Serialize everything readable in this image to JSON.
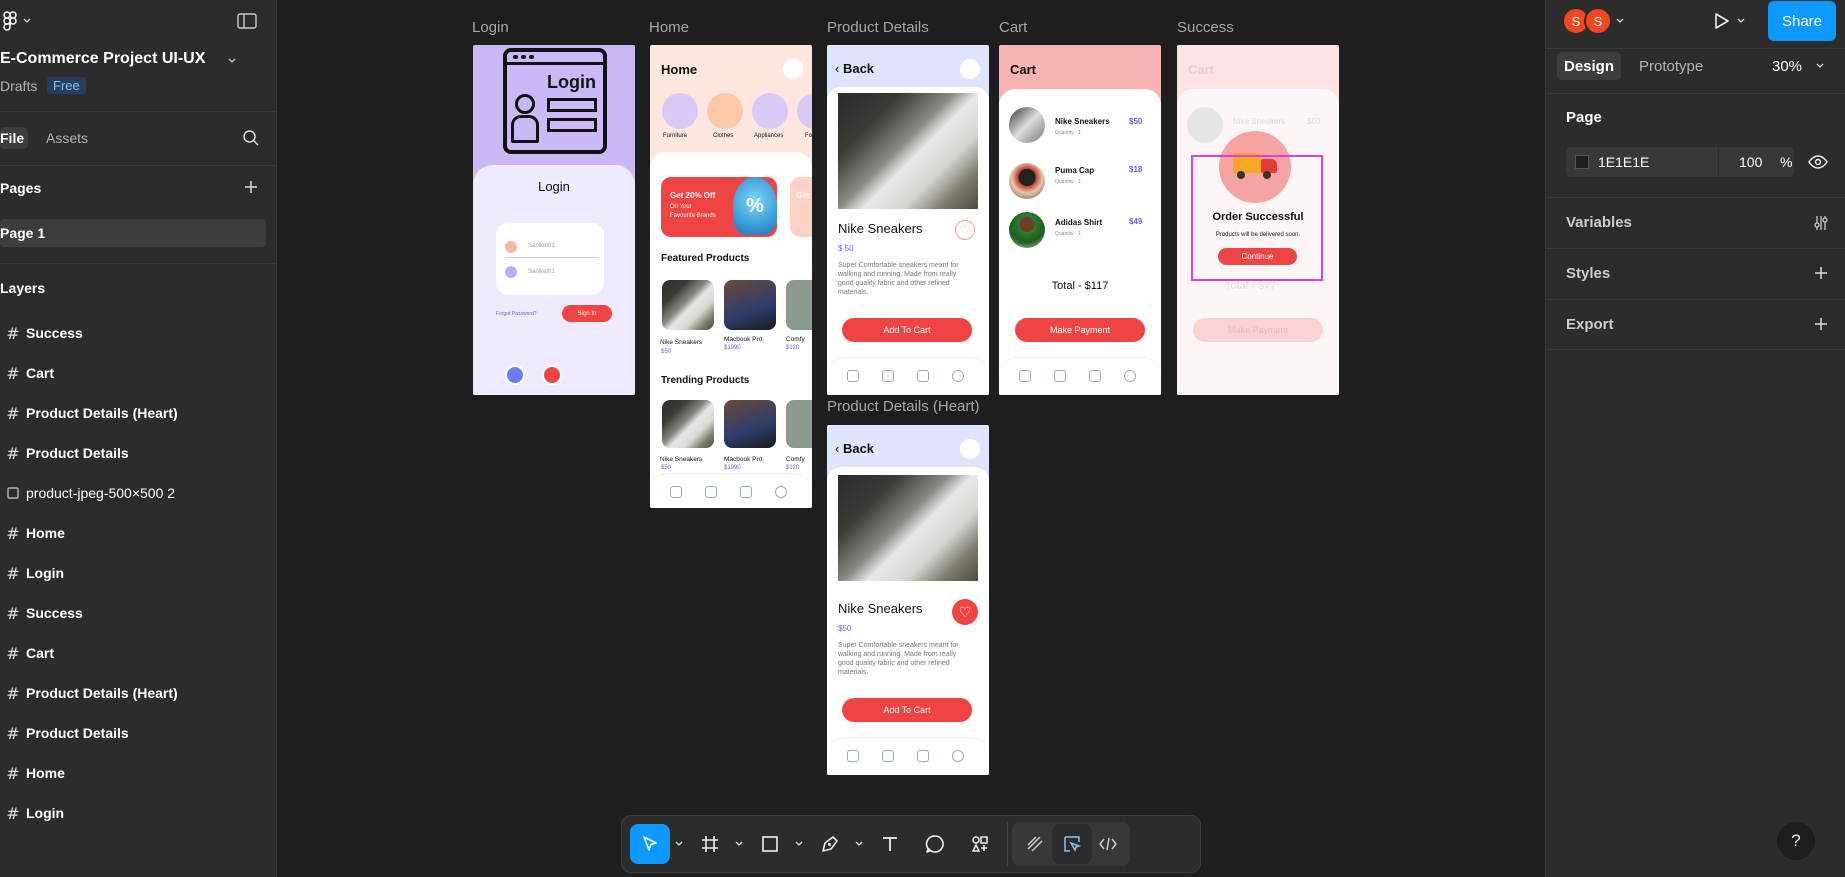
{
  "left": {
    "project_title": "E-Commerce Project UI-UX",
    "drafts": "Drafts",
    "plan_badge": "Free",
    "tabs": [
      "File",
      "Assets"
    ],
    "pages_heading": "Pages",
    "page_item": "Page 1",
    "layers_heading": "Layers",
    "layers": [
      {
        "name": "Success",
        "icon": "frame-icon"
      },
      {
        "name": "Cart",
        "icon": "frame-icon"
      },
      {
        "name": "Product Details (Heart)",
        "icon": "frame-icon"
      },
      {
        "name": "Product Details",
        "icon": "frame-icon"
      },
      {
        "name": "product-jpeg-500×500 2",
        "icon": "image-icon"
      },
      {
        "name": "Home",
        "icon": "frame-icon"
      },
      {
        "name": "Login",
        "icon": "frame-icon"
      },
      {
        "name": "Success",
        "icon": "frame-icon"
      },
      {
        "name": "Cart",
        "icon": "frame-icon"
      },
      {
        "name": "Product Details (Heart)",
        "icon": "frame-icon"
      },
      {
        "name": "Product Details",
        "icon": "frame-icon"
      },
      {
        "name": "Home",
        "icon": "frame-icon"
      },
      {
        "name": "Login",
        "icon": "frame-icon"
      }
    ]
  },
  "canvas": {
    "frame_labels": {
      "login": "Login",
      "home": "Home",
      "product_details": "Product Details",
      "cart": "Cart",
      "success": "Success",
      "product_details_heart": "Product Details (Heart)"
    },
    "login": {
      "illustration_text": "Login",
      "title": "Login",
      "username": "Saniket01",
      "password": "Saniket01",
      "forgot": "Forgot Password?",
      "sign_in": "Sign In"
    },
    "home": {
      "title": "Home",
      "categories": [
        "Furniture",
        "Clothes",
        "Appliances",
        "Fo"
      ],
      "banner_line1": "Get 20% Off",
      "banner_line2": "On Your",
      "banner_line3": "Favourite Brands",
      "banner_badge": "%",
      "banner2_text": "Get",
      "featured_heading": "Featured Products",
      "trending_heading": "Trending Products",
      "products": [
        {
          "name": "Nike Sneakers",
          "price": "$50"
        },
        {
          "name": "Macbook Pro",
          "price": "$1990"
        },
        {
          "name": "Comfy",
          "price": "$120"
        }
      ]
    },
    "product": {
      "back": "Back",
      "name": "Nike Sneakers",
      "price": "$ 50",
      "price_heart": "$50",
      "description": "Super Comfortable sneakers meant for walking and running. Made from really good quality fabric and other refined materials.",
      "add_to_cart": "Add To Cart"
    },
    "cart": {
      "title": "Cart",
      "quantity_label": "Quantity - 1",
      "items": [
        {
          "name": "Nike Sneakers",
          "price": "$50"
        },
        {
          "name": "Puma Cap",
          "price": "$18"
        },
        {
          "name": "Adidas Shirt",
          "price": "$49"
        }
      ],
      "total": "Total - $117",
      "make_payment": "Make Payment"
    },
    "success": {
      "bg_title": "Cart",
      "bg_item": "Nike Sneakers",
      "bg_price": "$50",
      "bg_total": "Total - $77",
      "bg_payment": "Make Payment",
      "title": "Order Successful",
      "subtitle": "Products will be delivered soon.",
      "continue": "Continue"
    }
  },
  "toolbar": {
    "tools": [
      "move-tool",
      "frame-tool",
      "rectangle-tool",
      "pen-tool",
      "text-tool",
      "comment-tool",
      "actions-tool",
      "draw-mode",
      "design-mode",
      "dev-mode"
    ]
  },
  "right": {
    "avatars": [
      "S",
      "S"
    ],
    "share": "Share",
    "tabs": [
      "Design",
      "Prototype"
    ],
    "zoom": "30%",
    "page_heading": "Page",
    "bg_color_hex": "1E1E1E",
    "bg_opacity": "100",
    "percent": "%",
    "variables": "Variables",
    "styles": "Styles",
    "export": "Export",
    "help": "?"
  },
  "colors": {
    "accent": "#0d99ff",
    "brand_red": "#ef4444",
    "avatar": "#f24822",
    "canvas_bg": "#1e1e1e",
    "selection": "#e040d8"
  }
}
